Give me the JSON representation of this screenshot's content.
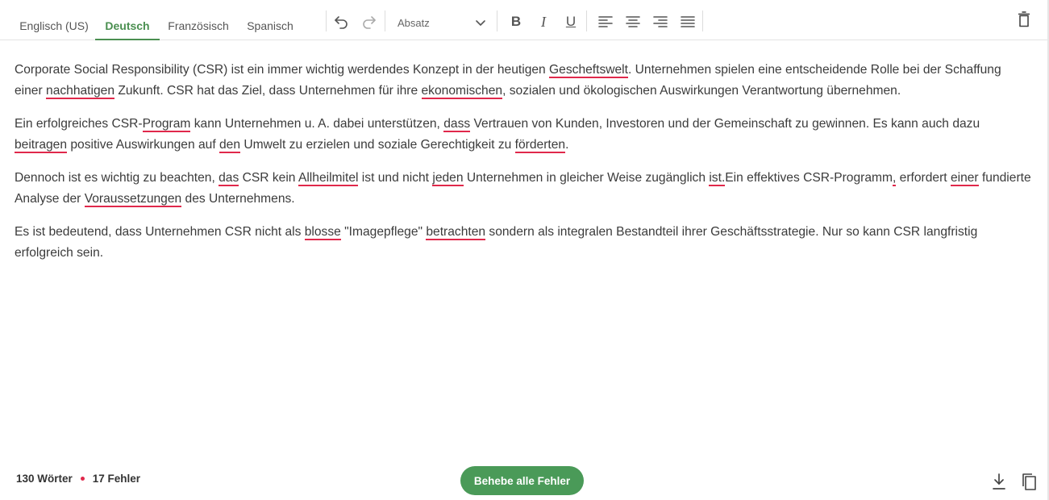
{
  "tabs": [
    {
      "label": "Englisch (US)",
      "active": false
    },
    {
      "label": "Deutsch",
      "active": true
    },
    {
      "label": "Französisch",
      "active": false
    },
    {
      "label": "Spanisch",
      "active": false
    }
  ],
  "toolbar": {
    "format_value": "Absatz",
    "bold": "B",
    "italic": "I",
    "underline": "U"
  },
  "icons": {
    "undo": "undo-icon",
    "redo": "redo-icon",
    "dropdown": "chevron-down-icon",
    "align_left": "align-left-icon",
    "align_center": "align-center-icon",
    "align_right": "align-right-icon",
    "align_justify": "align-justify-icon",
    "delete": "trash-icon",
    "download": "download-icon",
    "copy": "copy-icon"
  },
  "colors": {
    "accent": "#4a8f50",
    "button": "#4a9a58",
    "error": "#e0284b"
  },
  "editor": {
    "paragraphs": [
      [
        {
          "t": "Corporate Social Responsibility (CSR) ist ein immer wichtig werdendes Konzept in der heutigen "
        },
        {
          "t": "Gescheftswelt",
          "err": true
        },
        {
          "t": ". Unternehmen spielen eine entscheidende Rolle bei der Schaffung einer "
        },
        {
          "t": "nachhatigen",
          "err": true
        },
        {
          "t": " Zukunft. CSR hat das Ziel, dass Unternehmen für ihre "
        },
        {
          "t": "ekonomischen",
          "err": true
        },
        {
          "t": ", sozialen und ökologischen Auswirkungen Verantwortung übernehmen."
        }
      ],
      [
        {
          "t": "Ein erfolgreiches CSR-"
        },
        {
          "t": "Program",
          "err": true
        },
        {
          "t": " kann Unternehmen u. A. dabei unterstützen, "
        },
        {
          "t": "dass",
          "err": true
        },
        {
          "t": " Vertrauen von Kunden, Investoren und der Gemeinschaft zu gewinnen. Es kann auch dazu "
        },
        {
          "t": "beitragen",
          "err": true
        },
        {
          "t": " positive Auswirkungen auf "
        },
        {
          "t": "den",
          "err": true
        },
        {
          "t": " Umwelt zu erzielen und soziale Gerechtigkeit zu "
        },
        {
          "t": "förderten",
          "err": true
        },
        {
          "t": "."
        }
      ],
      [
        {
          "t": "Dennoch ist es wichtig zu beachten, "
        },
        {
          "t": "das",
          "err": true
        },
        {
          "t": " CSR kein "
        },
        {
          "t": "Allheilmitel",
          "err": true
        },
        {
          "t": " ist und nicht "
        },
        {
          "t": "jeden",
          "err": true
        },
        {
          "t": " Unternehmen in gleicher Weise zugänglich "
        },
        {
          "t": "ist.",
          "err": true
        },
        {
          "t": "Ein effektives CSR-Programm"
        },
        {
          "t": ",",
          "err": true
        },
        {
          "t": " erfordert "
        },
        {
          "t": "einer",
          "err": true
        },
        {
          "t": " fundierte Analyse der "
        },
        {
          "t": "Voraussetzungen",
          "err": true
        },
        {
          "t": " des Unternehmens."
        }
      ],
      [
        {
          "t": "Es ist bedeutend, dass Unternehmen CSR nicht als "
        },
        {
          "t": "blosse",
          "err": true
        },
        {
          "t": " \"Imagepflege\" "
        },
        {
          "t": "betrachten",
          "err": true
        },
        {
          "t": " sondern als integralen Bestandteil ihrer Geschäftsstrategie. Nur so kann CSR langfristig erfolgreich sein."
        }
      ]
    ]
  },
  "footer": {
    "words": "130 Wörter",
    "errors": "17 Fehler",
    "fix_button": "Behebe alle Fehler"
  }
}
